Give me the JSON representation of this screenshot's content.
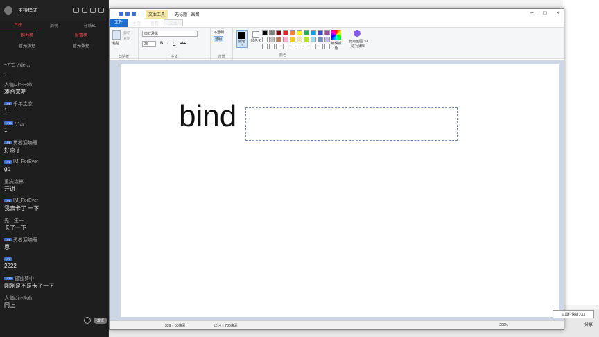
{
  "live": {
    "mode": "主持模式",
    "tabs": [
      "日榜",
      "周榜",
      "在线62"
    ],
    "ranks": [
      {
        "title": "魅力榜",
        "empty": "暂无数据"
      },
      {
        "title": "财富榜",
        "empty": "暂无数据"
      }
    ],
    "chat": [
      {
        "user": "~7℃ヤde灬",
        "badge": "",
        "text": "、"
      },
      {
        "user": "人偏/Jin-Roh",
        "badge": "",
        "text": "凑合来吧"
      },
      {
        "user": "千年之恋",
        "badge": "LV8",
        "text": "1"
      },
      {
        "user": "小云",
        "badge": "LV15",
        "text": "1"
      },
      {
        "user": "勇者迎熵雁",
        "badge": "LV8",
        "text": "好点了"
      },
      {
        "user": "IM_ForEver",
        "badge": "LV6",
        "text": "go"
      },
      {
        "user": "重庆森林",
        "badge": "",
        "text": "开讲"
      },
      {
        "user": "IM_ForEver",
        "badge": "LV6",
        "text": "我去卡了 一下"
      },
      {
        "user": "先、生一",
        "badge": "",
        "text": "卡了一下"
      },
      {
        "user": "勇者迎熵雁",
        "badge": "LV8",
        "text": "恩"
      },
      {
        "user": "",
        "badge": "LV1",
        "text": "2222"
      },
      {
        "user": "孤独夢中",
        "badge": "LV15",
        "text": "刚刚是不是卡了一下"
      },
      {
        "user": "人偏/Jin-Roh",
        "badge": "",
        "text": "同上"
      }
    ],
    "send": "发送"
  },
  "paint": {
    "tool_tab": "文本工具",
    "title": "无标题 - 画图",
    "tabs": [
      "文件",
      "主页",
      "查看",
      "文本"
    ],
    "clipboard": {
      "paste": "粘贴",
      "cut": "剪切",
      "copy": "复制",
      "label": "剪贴板"
    },
    "font": {
      "name": "微软雅黑",
      "size": "36",
      "bold": "B",
      "italic": "I",
      "underline": "U",
      "strike": "abc",
      "label": "字体"
    },
    "background": {
      "opaque": "不透明",
      "transparent": "透明",
      "label": "背景"
    },
    "colors": {
      "color1": "颜色 1",
      "color2": "颜色 2",
      "edit": "编辑颜色",
      "paint3d": "使用画图 3D 进行编辑",
      "label": "颜色",
      "swatches": [
        "#000000",
        "#7f7f7f",
        "#880015",
        "#ed1c24",
        "#ff7f27",
        "#fff200",
        "#22b14c",
        "#00a2e8",
        "#3f48cc",
        "#a349a4",
        "#ffffff",
        "#c3c3c3",
        "#b97a57",
        "#ffaec9",
        "#ffc90e",
        "#efe4b0",
        "#b5e61d",
        "#99d9ea",
        "#7092be",
        "#c8bfe7",
        "#ffffff",
        "#ffffff",
        "#ffffff",
        "#ffffff",
        "#ffffff",
        "#ffffff",
        "#ffffff",
        "#ffffff",
        "#ffffff",
        "#ffffff"
      ]
    },
    "canvas_text": "bind",
    "status": {
      "selection": "339 × 50像素",
      "size": "1214 × 736像素",
      "zoom": "200%"
    }
  },
  "taskbar": {
    "tool_entry": "工具栏快捷入口",
    "share": "分享"
  }
}
